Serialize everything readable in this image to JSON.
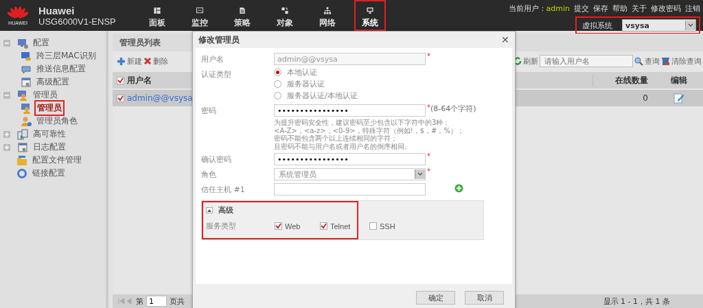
{
  "brand": {
    "logo_text": "HUAWEI",
    "name": "Huawei",
    "model": "USG6000V1-ENSP"
  },
  "nav": [
    {
      "label": "面板",
      "selected": false,
      "highlighted": false
    },
    {
      "label": "监控",
      "selected": false,
      "highlighted": false
    },
    {
      "label": "策略",
      "selected": false,
      "highlighted": false
    },
    {
      "label": "对象",
      "selected": false,
      "highlighted": false
    },
    {
      "label": "网络",
      "selected": false,
      "highlighted": false
    },
    {
      "label": "系统",
      "selected": true,
      "highlighted": true
    }
  ],
  "top_links": {
    "user_label": "当前用户：",
    "user": "admin",
    "links": [
      "提交",
      "保存",
      "帮助",
      "关于",
      "修改密码",
      "注销"
    ]
  },
  "vsys": {
    "label": "虚拟系统",
    "value": "vsysa",
    "highlighted": true
  },
  "sidebar": {
    "items": [
      {
        "label": "配置",
        "expanded": true,
        "selected": false,
        "highlighted": false,
        "children": [
          {
            "label": "跨三层MAC识别",
            "selected": false,
            "highlighted": false
          },
          {
            "label": "推送信息配置",
            "selected": false,
            "highlighted": false
          },
          {
            "label": "高级配置",
            "selected": false,
            "highlighted": false
          }
        ]
      },
      {
        "label": "管理员",
        "expanded": true,
        "selected": false,
        "highlighted": false,
        "children": [
          {
            "label": "管理员",
            "selected": true,
            "highlighted": true
          },
          {
            "label": "管理员角色",
            "selected": false,
            "highlighted": false
          }
        ]
      },
      {
        "label": "高可靠性",
        "expanded": false,
        "selected": false,
        "highlighted": false
      },
      {
        "label": "日志配置",
        "expanded": false,
        "selected": false,
        "highlighted": false
      },
      {
        "label": "配置文件管理",
        "selected": false,
        "highlighted": false
      },
      {
        "label": "链接配置",
        "selected": false,
        "highlighted": false
      }
    ]
  },
  "panel": {
    "title": "管理员列表",
    "toolbar": {
      "new": "新建",
      "delete": "删除",
      "refresh": "刷新",
      "search_placeholder": "请输入用户名",
      "query": "查询",
      "clear": "清除查询"
    },
    "table": {
      "columns": [
        "用户名",
        "在线数量",
        "编辑"
      ],
      "header_checked": true,
      "rows": [
        {
          "username": "admin@@vsysa",
          "online": "0",
          "checked": true
        }
      ]
    },
    "pager": {
      "page_label": "第",
      "page": "1",
      "of_label": "页共",
      "summary": "显示 1 - 1，共 1 条"
    }
  },
  "dialog": {
    "title": "修改管理员",
    "close": "✕",
    "username": {
      "label": "用户名",
      "value": "admin@@vsysa",
      "disabled": true,
      "required_mark": "*"
    },
    "auth": {
      "label": "认证类型",
      "options": [
        {
          "label": "本地认证",
          "selected": true
        },
        {
          "label": "服务器认证",
          "selected": false
        },
        {
          "label": "服务器认证/本地认证",
          "selected": false
        }
      ]
    },
    "password": {
      "label": "密码",
      "value": "••••••••••••••••",
      "required_mark": "*",
      "note": "(8-64个字符)"
    },
    "hint": [
      "为提升密码安全性，建议密码至少包含以下字符中的3种：",
      "<A-Z>，<a-z>，<0-9>，特殊字符（例如!，$，#，%）；",
      "密码不能包含两个以上连续相同的字符；",
      "且密码不能与用户名或者用户名的倒序相同。"
    ],
    "confirm": {
      "label": "确认密码",
      "value": "••••••••••••••••",
      "required_mark": "*"
    },
    "role": {
      "label": "角色",
      "value": "系统管理员",
      "required_mark": "*"
    },
    "trusted_host": {
      "label": "信任主机 #1"
    },
    "advanced": {
      "label": "高级",
      "expanded": true,
      "highlighted": true,
      "service_label": "服务类型",
      "services": [
        {
          "label": "Web",
          "checked": true
        },
        {
          "label": "Telnet",
          "checked": true
        },
        {
          "label": "SSH",
          "checked": false
        }
      ]
    },
    "buttons": [
      "确定",
      "取消"
    ]
  }
}
